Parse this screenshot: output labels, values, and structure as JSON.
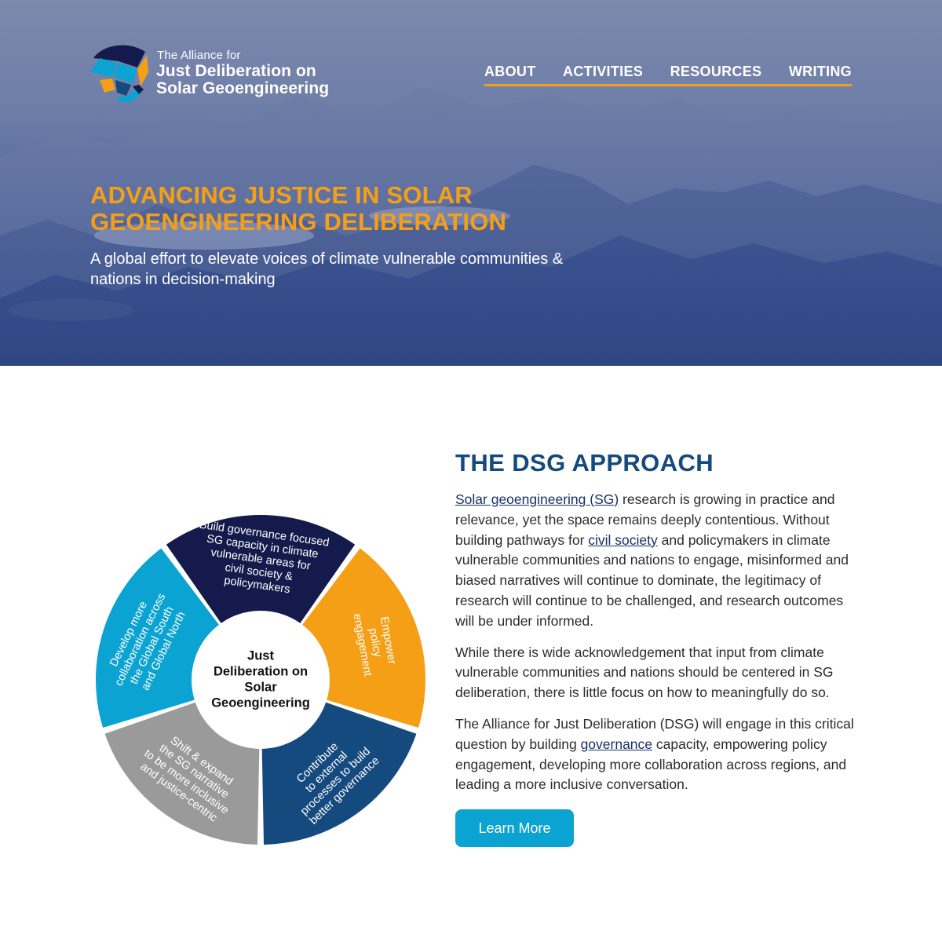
{
  "logo": {
    "small": "The Alliance for",
    "line1": "Just Deliberation on",
    "line2": "Solar Geoengineering"
  },
  "nav": [
    {
      "label": "ABOUT"
    },
    {
      "label": "ACTIVITIES"
    },
    {
      "label": "RESOURCES"
    },
    {
      "label": "WRITING"
    }
  ],
  "hero": {
    "title_line1": "ADVANCING JUSTICE IN SOLAR",
    "title_line2": "GEOENGINEERING DELIBERATION",
    "subtitle_line1": "A global effort to elevate voices of climate vulnerable communities &",
    "subtitle_line2": "nations in decision-making"
  },
  "wheel": {
    "center": [
      "Just",
      "Deliberation on",
      "Solar",
      "Geoengineering"
    ],
    "segments": [
      {
        "lines": [
          "Build governance focused",
          "SG capacity in climate",
          "vulnerable areas for",
          "civil society &",
          "policymakers"
        ],
        "color": "#141a4b"
      },
      {
        "lines": [
          "Empower",
          "policy",
          "engagement"
        ],
        "color": "#f59f17"
      },
      {
        "lines": [
          "Contribute",
          "to external",
          "processes to build",
          "better governance"
        ],
        "color": "#154a7e"
      },
      {
        "lines": [
          "Shift & expand",
          "the SG narrative",
          "to be more inclusive",
          "and justice-centric"
        ],
        "color": "#9a9a9a"
      },
      {
        "lines": [
          "Develop more",
          "collaboration across",
          "the Global South",
          "and Global North"
        ],
        "color": "#0ba3d2"
      }
    ]
  },
  "approach": {
    "heading": "THE DSG APPROACH",
    "p1_link1": "Solar geoengineering (SG)",
    "p1_text1": " research is growing in practice and relevance, yet the space remains deeply contentious. Without building pathways for ",
    "p1_link2": "civil society",
    "p1_text2": " and policymakers in climate vulnerable communities and nations to engage, misinformed and biased narratives will continue to dominate, the legitimacy of research will continue to be challenged, and research outcomes will be under informed.",
    "p2": "While there is wide acknowledgement that input from climate vulnerable communities and nations should be centered in SG deliberation, there is little focus on how to meaningfully do so.",
    "p3_text1": "The Alliance for Just Deliberation (DSG) will engage in this critical question by building ",
    "p3_link": "governance",
    "p3_text2": " capacity, empowering policy engagement, developing more collaboration across regions, and leading a more inclusive conversation.",
    "button": "Learn More"
  },
  "colors": {
    "accent_orange": "#f59f17",
    "heading_blue": "#154a7e",
    "button_cyan": "#0ba3d2",
    "navy": "#141a4b"
  }
}
